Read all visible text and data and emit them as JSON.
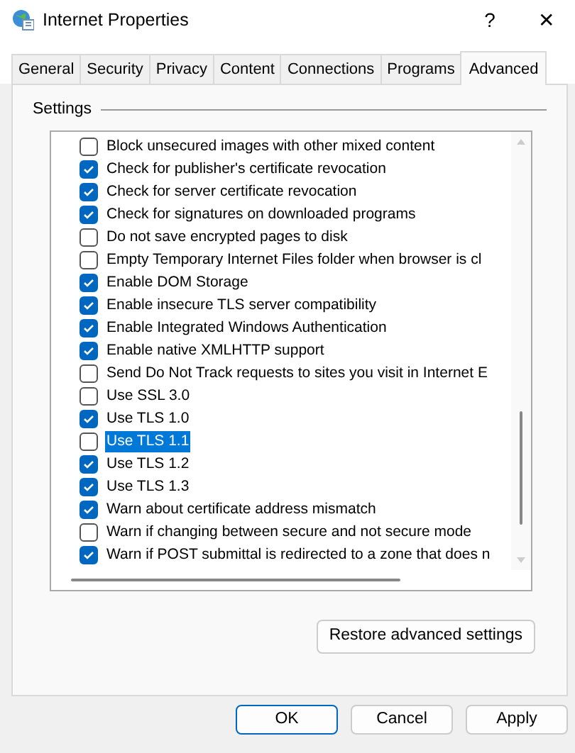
{
  "window": {
    "title": "Internet Properties",
    "help": "?",
    "close": "✕"
  },
  "tabs": [
    {
      "label": "General",
      "selected": false
    },
    {
      "label": "Security",
      "selected": false
    },
    {
      "label": "Privacy",
      "selected": false
    },
    {
      "label": "Content",
      "selected": false
    },
    {
      "label": "Connections",
      "selected": false
    },
    {
      "label": "Programs",
      "selected": false
    },
    {
      "label": "Advanced",
      "selected": true
    }
  ],
  "settings": {
    "title": "Settings",
    "items": [
      {
        "label": "Block unsecured images with other mixed content",
        "checked": false,
        "selected": false
      },
      {
        "label": "Check for publisher's certificate revocation",
        "checked": true,
        "selected": false
      },
      {
        "label": "Check for server certificate revocation",
        "checked": true,
        "selected": false
      },
      {
        "label": "Check for signatures on downloaded programs",
        "checked": true,
        "selected": false
      },
      {
        "label": "Do not save encrypted pages to disk",
        "checked": false,
        "selected": false
      },
      {
        "label": "Empty Temporary Internet Files folder when browser is cl",
        "checked": false,
        "selected": false
      },
      {
        "label": "Enable DOM Storage",
        "checked": true,
        "selected": false
      },
      {
        "label": "Enable insecure TLS server compatibility",
        "checked": true,
        "selected": false
      },
      {
        "label": "Enable Integrated Windows Authentication",
        "checked": true,
        "selected": false
      },
      {
        "label": "Enable native XMLHTTP support",
        "checked": true,
        "selected": false
      },
      {
        "label": "Send Do Not Track requests to sites you visit in Internet E",
        "checked": false,
        "selected": false
      },
      {
        "label": "Use SSL 3.0",
        "checked": false,
        "selected": false
      },
      {
        "label": "Use TLS 1.0",
        "checked": true,
        "selected": false
      },
      {
        "label": "Use TLS 1.1",
        "checked": false,
        "selected": true
      },
      {
        "label": "Use TLS 1.2",
        "checked": true,
        "selected": false
      },
      {
        "label": "Use TLS 1.3",
        "checked": true,
        "selected": false
      },
      {
        "label": "Warn about certificate address mismatch",
        "checked": true,
        "selected": false
      },
      {
        "label": "Warn if changing between secure and not secure mode",
        "checked": false,
        "selected": false
      },
      {
        "label": "Warn if POST submittal is redirected to a zone that does n",
        "checked": true,
        "selected": false
      }
    ],
    "restore_button": "Restore advanced settings"
  },
  "buttons": [
    {
      "label": "OK",
      "default": true
    },
    {
      "label": "Cancel",
      "default": false
    },
    {
      "label": "Apply",
      "default": false
    }
  ]
}
